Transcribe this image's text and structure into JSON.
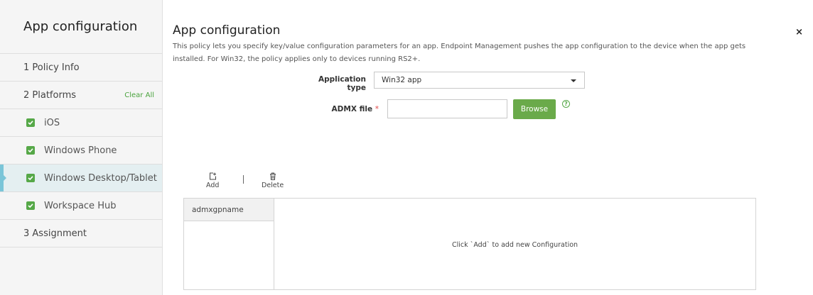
{
  "sidebar": {
    "title": "App configuration",
    "step1": "1  Policy Info",
    "step2": "2  Platforms",
    "clear_all": "Clear All",
    "platforms": [
      {
        "label": "iOS",
        "checked": true
      },
      {
        "label": "Windows Phone",
        "checked": true
      },
      {
        "label": "Windows Desktop/Tablet",
        "checked": true
      },
      {
        "label": "Workspace Hub",
        "checked": true
      }
    ],
    "step3": "3  Assignment"
  },
  "main": {
    "title": "App configuration",
    "description": "This policy lets you specify key/value configuration parameters for an app. Endpoint Management pushes the app configuration to the device when the app gets installed. For Win32, the policy applies only to devices running RS2+.",
    "close_icon": "×",
    "app_type_label": "Application type",
    "app_type_value": "Win32 app",
    "admx_label": "ADMX file",
    "required_mark": "*",
    "admx_value": "",
    "browse_label": "Browse",
    "help_icon": "?",
    "toolbar": {
      "add_label": "Add",
      "delete_label": "Delete"
    },
    "grid": {
      "column": "admxgpname",
      "empty_text": "Click `Add` to add new Configuration"
    }
  },
  "colors": {
    "accent_green": "#56a848",
    "active_bar": "#7ac5d8",
    "required_red": "#e04646"
  }
}
